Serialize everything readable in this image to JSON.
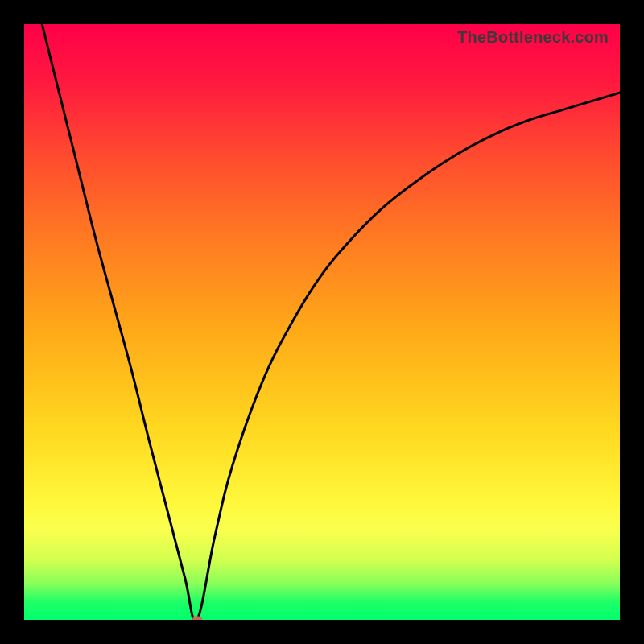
{
  "attribution": "TheBottleneck.com",
  "chart_data": {
    "type": "line",
    "title": "",
    "xlabel": "",
    "ylabel": "",
    "xlim": [
      0,
      100
    ],
    "ylim": [
      0,
      100
    ],
    "grid": false,
    "legend": false,
    "series": [
      {
        "name": "curve",
        "x": [
          3,
          6,
          9,
          12,
          15,
          18,
          21,
          24,
          27,
          29,
          32,
          35,
          40,
          45,
          50,
          55,
          60,
          65,
          70,
          75,
          80,
          85,
          90,
          95,
          100
        ],
        "y": [
          100,
          88,
          76,
          64,
          53,
          42,
          30,
          18.5,
          7,
          0,
          14,
          26,
          40,
          50,
          58,
          64,
          69,
          73,
          76.5,
          79.5,
          82,
          84,
          85.5,
          87,
          88.5
        ]
      }
    ],
    "marker": {
      "x": 29,
      "y": 0,
      "color": "#c86a52"
    },
    "background_gradient": {
      "top": "#ff0048",
      "mid_upper": "#ffab18",
      "mid": "#fff73a",
      "lower": "#86ff5a",
      "bottom": "#00ff6e"
    }
  }
}
